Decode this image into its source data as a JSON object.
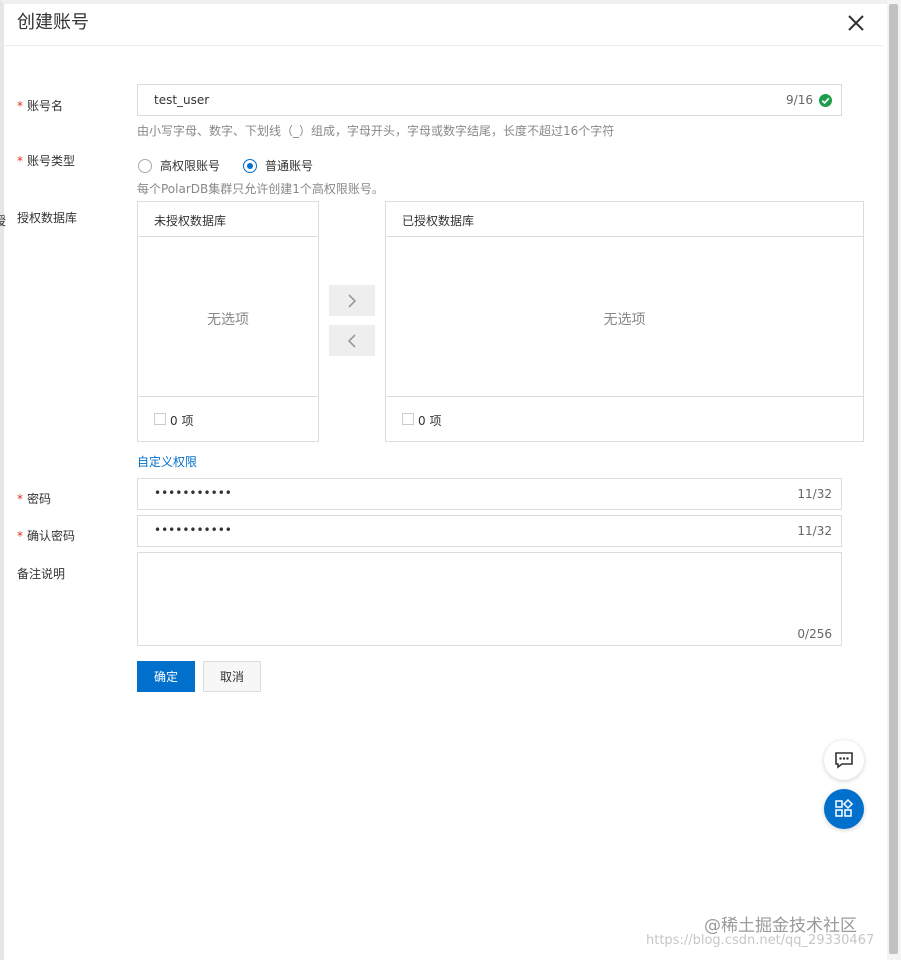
{
  "dialog": {
    "title": "创建账号"
  },
  "account_name": {
    "label": "账号名",
    "value": "test_user",
    "counter": "9/16",
    "help": "由小写字母、数字、下划线（_）组成，字母开头，字母或数字结尾，长度不超过16个字符"
  },
  "account_type": {
    "label": "账号类型",
    "options": [
      "高权限账号",
      "普通账号"
    ],
    "selected": "普通账号",
    "help": "每个PolarDB集群只允许创建1个高权限账号。"
  },
  "authorized_db": {
    "label": "授权数据库",
    "left_panel": {
      "title": "未授权数据库",
      "empty": "无选项",
      "count": "0 项"
    },
    "right_panel": {
      "title": "已授权数据库",
      "empty": "无选项",
      "count": "0 项"
    }
  },
  "custom_permission": {
    "label": "自定义权限"
  },
  "password": {
    "label": "密码",
    "value": "•••••••••••",
    "counter": "11/32"
  },
  "confirm_password": {
    "label": "确认密码",
    "value": "•••••••••••",
    "counter": "11/32"
  },
  "remark": {
    "label": "备注说明",
    "counter": "0/256"
  },
  "actions": {
    "confirm": "确定",
    "cancel": "取消"
  },
  "watermark": {
    "brand": "@稀土掘金技术社区",
    "url": "https://blog.csdn.net/qq_29330467"
  },
  "colors": {
    "primary": "#0070cc",
    "required": "#e0301e",
    "success": "#1e9e4a"
  }
}
